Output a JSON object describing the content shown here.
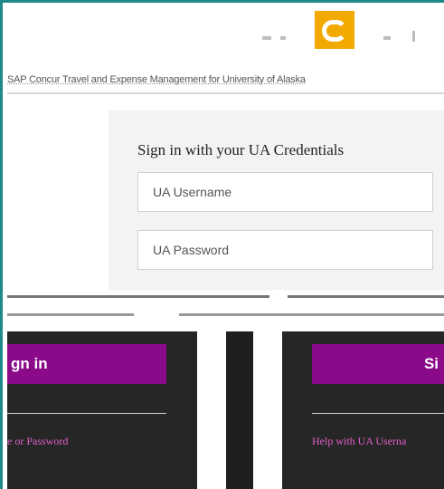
{
  "header": {
    "logo_icon": "concur-logo-icon",
    "logo_color": "#f2a900",
    "banner_text": "SAP Concur Travel and Expense Management for University of Alaska"
  },
  "signin": {
    "title": "Sign in with your UA Credentials",
    "username_placeholder": "UA Username",
    "password_placeholder": "UA Password"
  },
  "left_panel": {
    "button_label": "gn in",
    "help_link": "e or Password"
  },
  "right_panel": {
    "button_label": "Si",
    "help_link": "Help with UA Userna"
  },
  "colors": {
    "accent_button": "#8a0a8a",
    "dark_panel": "#262626",
    "frame_border": "#1f8a8a",
    "link": "#e060c8"
  }
}
